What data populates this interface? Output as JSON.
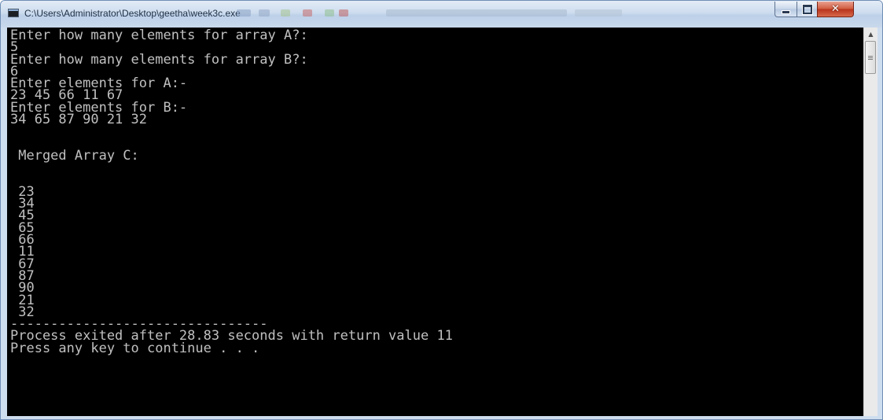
{
  "window": {
    "title": "C:\\Users\\Administrator\\Desktop\\geetha\\week3c.exe",
    "icons": {
      "app": "console-app-icon",
      "minimize": "minimize-icon",
      "maximize": "maximize-icon",
      "close": "close-icon"
    },
    "close_glyph": "✕"
  },
  "console": {
    "lines": [
      "Enter how many elements for array A?:",
      "5",
      "Enter how many elements for array B?:",
      "6",
      "Enter elements for A:-",
      "23 45 66 11 67",
      "Enter elements for B:-",
      "34 65 87 90 21 32",
      "",
      "",
      " Merged Array C:",
      "",
      "",
      " 23",
      " 34",
      " 45",
      " 65",
      " 66",
      " 11",
      " 67",
      " 87",
      " 90",
      " 21",
      " 32",
      "--------------------------------",
      "Process exited after 28.83 seconds with return value 11",
      "Press any key to continue . . ."
    ],
    "text_color": "#c0c0c0",
    "background": "#000000"
  },
  "scrollbar": {
    "up_arrow": "▲",
    "icons": {
      "up": "scroll-up-arrow-icon",
      "thumb": "scroll-thumb-grip-icon"
    }
  }
}
